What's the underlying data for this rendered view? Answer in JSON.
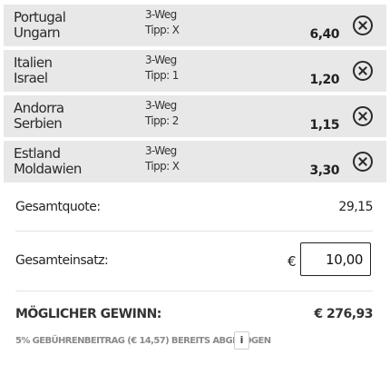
{
  "bets": [
    {
      "team1": "Portugal",
      "team2": "Ungarn",
      "market": "3-Weg",
      "tip": "Tipp: X",
      "odds": "6,40",
      "remove_icon": "close-circle-icon"
    },
    {
      "team1": "Italien",
      "team2": "Israel",
      "market": "3-Weg",
      "tip": "Tipp: 1",
      "odds": "1,20",
      "remove_icon": "close-circle-icon"
    },
    {
      "team1": "Andorra",
      "team2": "Serbien",
      "market": "3-Weg",
      "tip": "Tipp: 2",
      "odds": "1,15",
      "remove_icon": "close-circle-icon"
    },
    {
      "team1": "Estland",
      "team2": "Moldawien",
      "market": "3-Weg",
      "tip": "Tipp: X",
      "odds": "3,30",
      "remove_icon": "close-circle-icon"
    }
  ],
  "summary": {
    "total_odds_label": "Gesamtquote:",
    "total_odds_value": "29,15",
    "stake_label": "Gesamteinsatz:",
    "currency": "€",
    "stake_value": "10,00",
    "win_label": "MÖGLICHER GEWINN:",
    "win_value": "€ 276,93",
    "fee_note": "5% GEBÜHRENBEITRAG (€ 14,57) BEREITS ABGEZOGEN",
    "info_label": "i"
  },
  "colors": {
    "bet_background": "#e8e8e8",
    "text": "#222222",
    "muted_text": "#8a8a8a"
  }
}
